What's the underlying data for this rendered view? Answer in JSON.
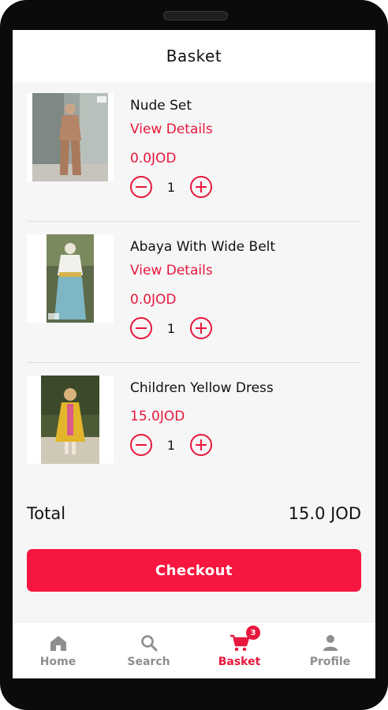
{
  "header": {
    "title": "Basket"
  },
  "items": [
    {
      "name": "Nude Set",
      "details_label": "View Details",
      "price": "0.0JOD",
      "quantity": "1"
    },
    {
      "name": "Abaya With Wide Belt",
      "details_label": "View Details",
      "price": "0.0JOD",
      "quantity": "1"
    },
    {
      "name": "Children Yellow Dress",
      "price": "15.0JOD",
      "quantity": "1"
    }
  ],
  "summary": {
    "total_label": "Total",
    "total_value": "15.0 JOD"
  },
  "checkout": {
    "label": "Checkout"
  },
  "tabbar": {
    "tabs": [
      {
        "label": "Home",
        "icon": "home-icon"
      },
      {
        "label": "Search",
        "icon": "search-icon"
      },
      {
        "label": "Basket",
        "icon": "cart-icon",
        "badge": "3"
      },
      {
        "label": "Profile",
        "icon": "profile-icon"
      }
    ],
    "active": "Basket"
  },
  "colors": {
    "accent": "#e8173d",
    "checkout": "#f7163f",
    "inactive_tab": "#8e8e8e",
    "background": "#f6f6f6"
  }
}
